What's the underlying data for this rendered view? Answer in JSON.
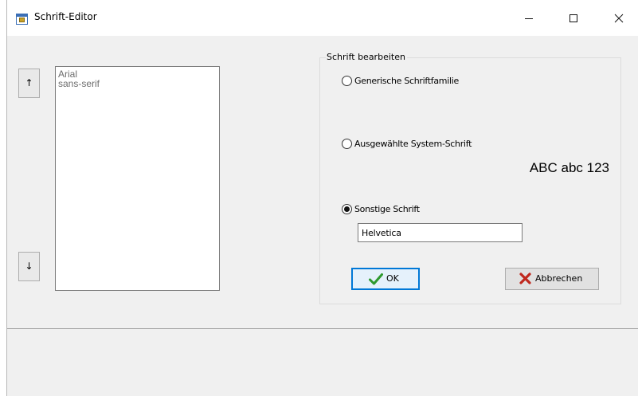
{
  "window": {
    "title": "Schrift-Editor",
    "icon": "font-editor-app-icon",
    "controls": {
      "minimize": "minimize-icon",
      "maximize": "maximize-icon",
      "close": "close-icon"
    }
  },
  "list_controls": {
    "up_label": "↑",
    "down_label": "↓"
  },
  "font_list": {
    "items": [
      "Arial",
      "sans-serif"
    ]
  },
  "editor": {
    "group_title": "Schrift bearbeiten",
    "options": {
      "generic": {
        "label": "Generische Schriftfamilie",
        "selected": false
      },
      "system": {
        "label": "Ausgewählte System-Schrift",
        "selected": false
      },
      "other": {
        "label": "Sonstige Schrift",
        "selected": true
      }
    },
    "preview": "ABC abc 123",
    "other_font_value": "Helvetica"
  },
  "buttons": {
    "ok_label": "OK",
    "ok_icon": "checkmark-icon",
    "cancel_label": "Abbrechen",
    "cancel_icon": "red-x-icon"
  },
  "colors": {
    "accent": "#0078d7",
    "ok_check": "#2e9a2e",
    "cancel_x": "#c0281e",
    "window_bg": "#f0f0f0"
  }
}
